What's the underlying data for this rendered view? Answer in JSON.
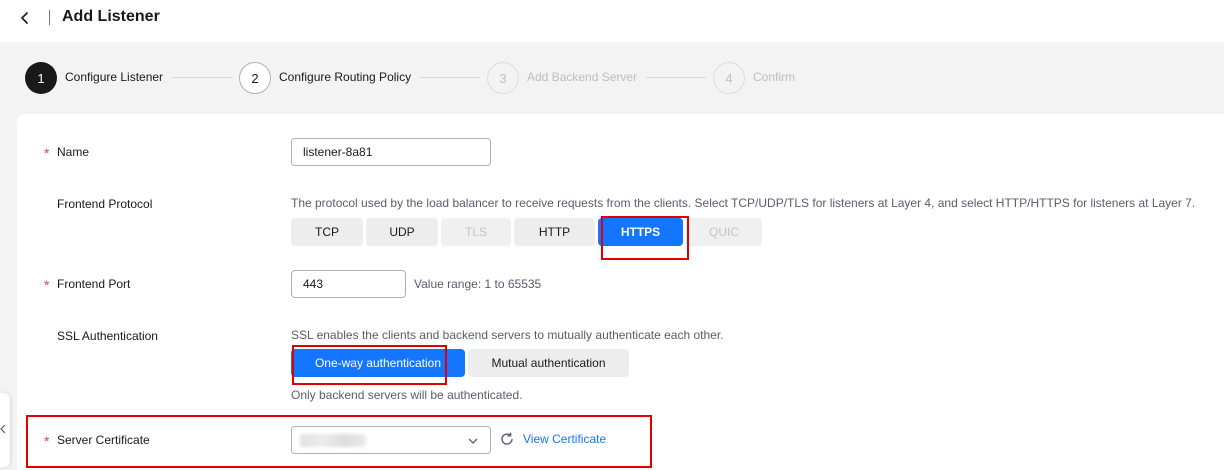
{
  "header": {
    "title": "Add Listener"
  },
  "steps": [
    {
      "num": "1",
      "label": "Configure Listener"
    },
    {
      "num": "2",
      "label": "Configure Routing Policy"
    },
    {
      "num": "3",
      "label": "Add Backend Server"
    },
    {
      "num": "4",
      "label": "Confirm"
    }
  ],
  "form": {
    "name": {
      "label": "Name",
      "value": "listener-8a81"
    },
    "protocol": {
      "label": "Frontend Protocol",
      "hint": "The protocol used by the load balancer to receive requests from the clients. Select TCP/UDP/TLS for listeners at Layer 4, and select HTTP/HTTPS for listeners at Layer 7.",
      "options": [
        "TCP",
        "UDP",
        "TLS",
        "HTTP",
        "HTTPS",
        "QUIC"
      ],
      "selected": "HTTPS"
    },
    "port": {
      "label": "Frontend Port",
      "value": "443",
      "hint": "Value range: 1 to 65535"
    },
    "ssl": {
      "label": "SSL Authentication",
      "hint": "SSL enables the clients and backend servers to mutually authenticate each other.",
      "options": [
        "One-way authentication",
        "Mutual authentication"
      ],
      "selected": "One-way authentication",
      "note": "Only backend servers will be authenticated."
    },
    "certificate": {
      "label": "Server Certificate",
      "link": "View Certificate"
    }
  },
  "colors": {
    "accent": "#1476ff",
    "required": "#e54545",
    "highlight": "#e00000"
  },
  "icons": [
    "back-arrow-icon",
    "chevron-down-icon",
    "refresh-icon",
    "collapse-chevron-icon"
  ]
}
